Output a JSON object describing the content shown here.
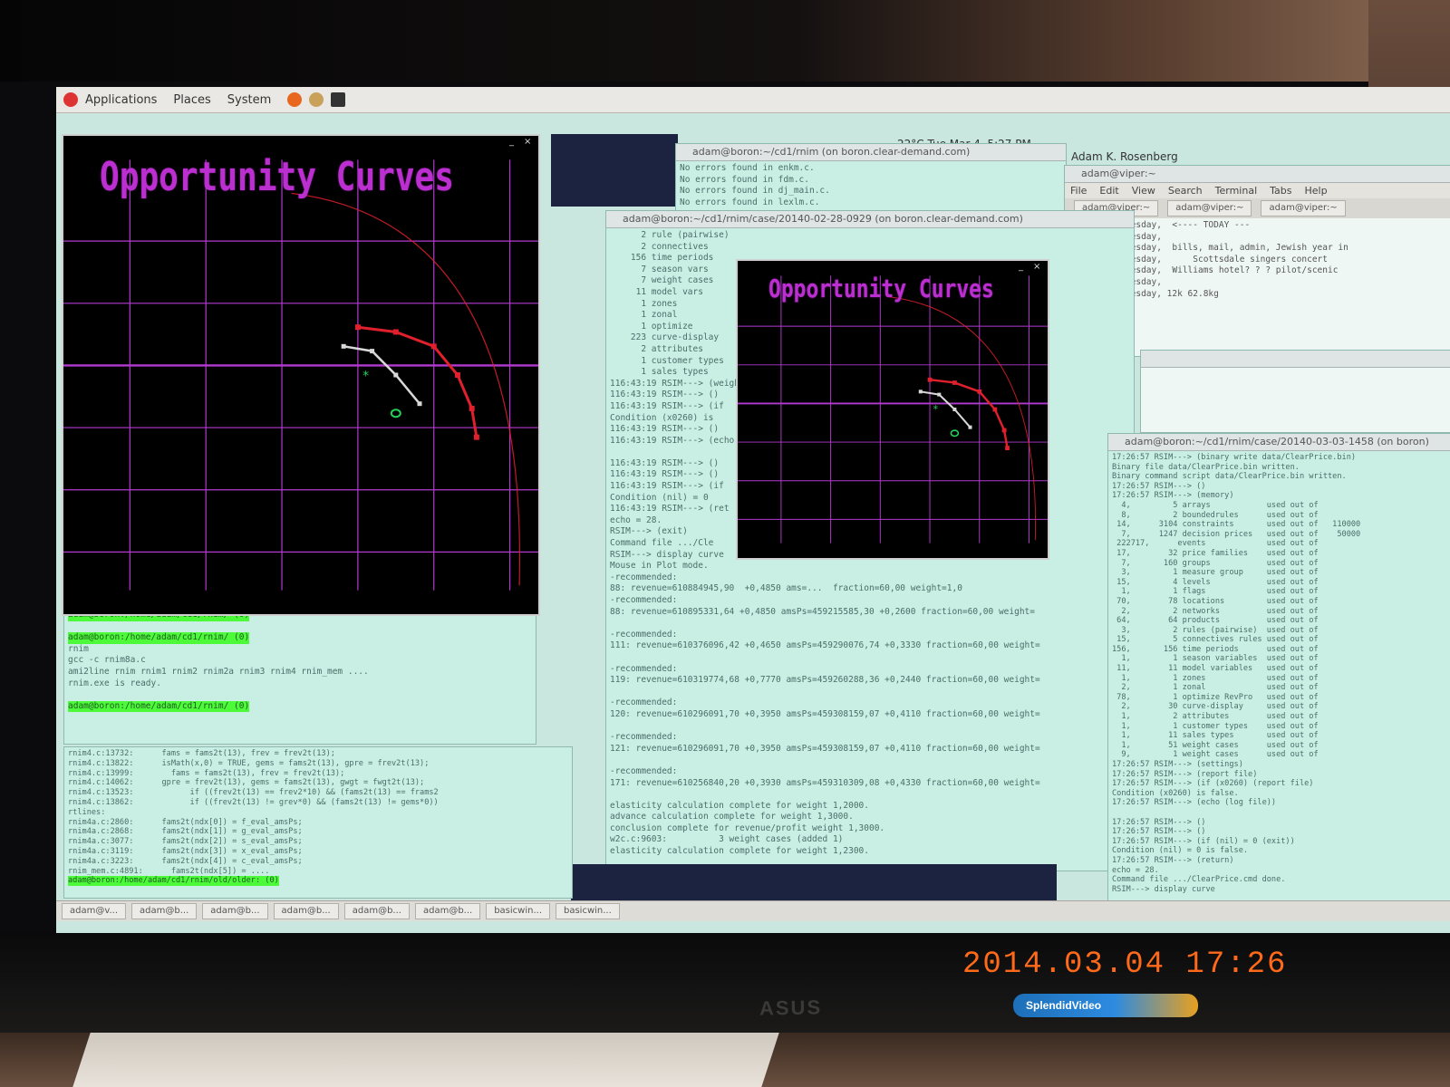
{
  "topbar": {
    "menus": [
      "Applications",
      "Places",
      "System"
    ]
  },
  "panel": {
    "clock": "22°C  Tue Mar 4, 5:27 PM",
    "user": "Adam K. Rosenberg"
  },
  "plots": [
    {
      "title": "Opportunity Curves"
    },
    {
      "title": "Opportunity Curves"
    }
  ],
  "windows": {
    "t1_title": "adam@boron:~/cd1/rnim (on boron.clear-demand.com)",
    "t1_lines": [
      "No errors found in enkm.c.",
      "No errors found in fdm.c.",
      "No errors found in dj_main.c.",
      "No errors found in lexlm.c."
    ],
    "t2_title": "adam@boron:~/cd1/rnim/case/20140-02-28-0929 (on boron.clear-demand.com)",
    "t2_lines": [
      "-recommended:",
      "88: revenue=610884945,90  +0,4850 ams=...  fraction=60,00 weight=1,0",
      "-recommended:",
      "88: revenue=610895331,64 +0,4850 amsPs=459215585,30 +0,2600 fraction=60,00 weight=",
      "-recommended:",
      "111: revenue=610376096,42 +0,4650 amsPs=459290076,74 +0,3330 fraction=60,00 weight=",
      "-recommended:",
      "119: revenue=610319774,68 +0,7770 amsPs=459260288,36 +0,2440 fraction=60,00 weight=",
      "-recommended:",
      "120: revenue=610296091,70 +0,3950 amsPs=459308159,07 +0,4110 fraction=60,00 weight=",
      "-recommended:",
      "121: revenue=610296091,70 +0,3950 amsPs=459308159,07 +0,4110 fraction=60,00 weight=",
      "-recommended:",
      "171: revenue=610256840,20 +0,3930 amsPs=459310309,08 +0,4330 fraction=60,00 weight=",
      "elasticity calculation complete for weight 1,2000.",
      "advance calculation complete for weight 1,3000.",
      "conclusion complete for revenue/profit weight 1,3000.",
      "w2c.c:9603:          3 weight cases (added 1)",
      "elasticity calculation complete for weight 1,2300."
    ],
    "t3_title": "adam@viper:~",
    "t3_menu": [
      "File",
      "Edit",
      "View",
      "Search",
      "Terminal",
      "Tabs",
      "Help"
    ],
    "t3_tabs": [
      "adam@viper:~",
      "adam@viper:~",
      "adam@viper:~"
    ],
    "t3_lines": [
      "ruary 25, Tuesday,  <---- TODAY ---",
      "ruary 25, Tuesday,",
      "ruary 25, Tuesday,  bills, mail, admin, Jewish year in",
      "ruary 25, Tuesday,      Scottsdale singers concert",
      "ruary 25, Tuesday,  Williams hotel? ? ? pilot/scenic",
      "ruary 25, Tuesday,",
      "ruary 25, Tuesday, 12k 62.8kg"
    ],
    "t4_title": "adam@boron:~/cd1/rnim/case/20140-03-03-1458 (on boron)",
    "t4_lines": [
      "17:26:57 RSIM---> (binary write data/ClearPrice.bin)",
      "Binary file data/ClearPrice.bin written.",
      "Binary command script data/ClearPrice.bin written.",
      "17:26:57 RSIM---> ()",
      "17:26:57 RSIM---> (memory)",
      "  4,         5 arrays            used out of",
      "  8,         2 boundedrules      used out of",
      " 14,      3104 constraints       used out of   110000",
      "  7,      1247 decision prices   used out of    50000",
      " 222717,      events             used out of",
      " 17,        32 price families    used out of",
      "  7,       160 groups            used out of",
      "  3,         1 measure group     used out of",
      " 15,         4 levels            used out of",
      "  1,         1 flags             used out of",
      " 70,        78 locations         used out of",
      "  2,         2 networks          used out of",
      " 64,        64 products          used out of",
      "  3,         2 rules (pairwise)  used out of",
      " 15,         5 connectives rules used out of",
      "156,       156 time periods      used out of",
      "  1,         1 season variables  used out of",
      " 11,        11 model variables   used out of",
      "  1,         1 zones             used out of",
      "  2,         1 zonal             used out of",
      " 78,         1 optimize RevPro   used out of",
      "  2,        30 curve-display     used out of",
      "  1,         2 attributes        used out of",
      "  1,         1 customer types    used out of",
      "  1,        11 sales types       used out of",
      "  1,        51 weight cases      used out of",
      "  9,         1 weight cases      used out of",
      "17:26:57 RSIM---> (settings)",
      "17:26:57 RSIM---> (report file)",
      "17:26:57 RSIM---> (if (x0260) (report file)",
      "Condition (x0260) is false.",
      "17:26:57 RSIM---> (echo (log file))",
      "",
      "17:26:57 RSIM---> ()",
      "17:26:57 RSIM---> ()",
      "17:26:57 RSIM---> (if (nil) = 0 (exit))",
      "Condition (nil) = 0 is false.",
      "17:26:57 RSIM---> (return)",
      "echo = 28.",
      "Command file .../ClearPrice.cmd done.",
      "RSIM---> display curve"
    ],
    "t5_lines": [
      "      2 rule (pairwise)",
      "      2 connectives",
      "    156 time periods",
      "      7 season vars",
      "      7 weight cases",
      "     11 model vars",
      "      1 zones",
      "      1 zonal",
      "      1 optimize",
      "    223 curve-display",
      "      2 attributes",
      "      1 customer types",
      "      1 sales types",
      "116:43:19 RSIM---> (weight)",
      "116:43:19 RSIM---> ()",
      "116:43:19 RSIM---> (if",
      "Condition (x0260) is",
      "116:43:19 RSIM---> ()",
      "116:43:19 RSIM---> (echo",
      "",
      "116:43:19 RSIM---> ()",
      "116:43:19 RSIM---> ()",
      "116:43:19 RSIM---> (if",
      "Condition (nil) = 0",
      "116:43:19 RSIM---> (ret",
      "echo = 28.",
      "RSIM---> (exit)",
      "Command file .../Cle",
      "RSIM---> display curve",
      "Mouse in Plot mode."
    ],
    "t6_lines": [
      "adam@boron:/home/adam/cd1/rnim/ (0)",
      "adam@boron:/home/adam/cd1/rnim/ (0)",
      "rnim",
      "gcc -c rnim8a.c",
      "ami2line rnim rnim1 rnim2 rnim2a rnim3 rnim4 rnim_mem ....",
      "rnim.exe is ready.",
      "adam@boron:/home/adam/cd1/rnim/ (0)"
    ],
    "t7_lines": [
      "rnim4.c:13732:      fams = fams2t(13), frev = frev2t(13);",
      "rnim4.c:13822:      isMath(x,0) = TRUE, gems = fams2t(13), gpre = frev2t(13);",
      "rnim4.c:13999:        fams = fams2t(13), frev = frev2t(13);",
      "rnim4.c:14062:      gpre = frev2t(13), gems = fams2t(13), gwgt = fwgt2t(13);",
      "rnim4.c:13523:            if ((frev2t(13) == frev2*10) && (fams2t(13) == frams2",
      "rnim4.c:13862:            if ((frev2t(13) != grev*0) && (fams2t(13) != gems*0))",
      "rtlines:",
      "rnim4a.c:2860:      fams2t(ndx[0]) = f_eval_amsPs;",
      "rnim4a.c:2868:      fams2t(ndx[1]) = g_eval_amsPs;",
      "rnim4a.c:3077:      fams2t(ndx[2]) = s_eval_amsPs;",
      "rnim4a.c:3119:      fams2t(ndx[3]) = x_eval_amsPs;",
      "rnim4a.c:3223:      fams2t(ndx[4]) = c_eval_amsPs;",
      "rnim_mem.c:4891:      fams2t(ndx[5]) = ....",
      "adam@boron:/home/adam/cd1/rnim/old/older: (0)"
    ],
    "date_stamp": "2014.03.04  17:26"
  },
  "taskbar": [
    "adam@v...",
    "adam@b...",
    "adam@b...",
    "adam@b...",
    "adam@b...",
    "adam@b...",
    "basicwin...",
    "basicwin..."
  ],
  "labels": {
    "brand": "ASUS",
    "sticker": "SplendidVideo"
  },
  "colors": {
    "plot_grid": "#b23ad0",
    "plot_title": "#bb2fd0",
    "curve_red": "#e0202c",
    "curve_white": "#d8d8d8",
    "marker_green": "#22d05a",
    "term_bg": "#c9efe5",
    "highlight": "#4dfa3a",
    "stamp": "#ff6a1a"
  }
}
